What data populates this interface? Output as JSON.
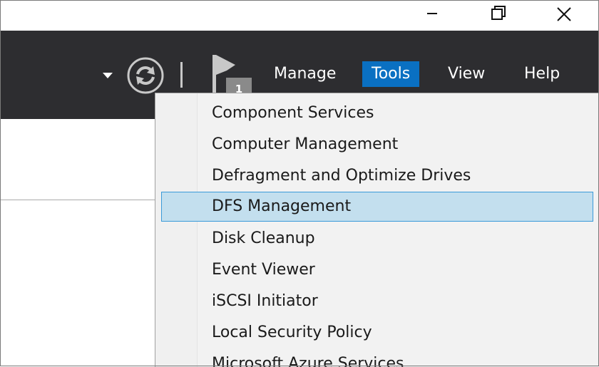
{
  "window_controls": {
    "minimize_icon": "minimize-icon",
    "restore_icon": "restore-icon",
    "close_icon": "close-icon"
  },
  "header": {
    "notification_count": "1",
    "menu": [
      {
        "label": "Manage"
      },
      {
        "label": "Tools",
        "active": true
      },
      {
        "label": "View"
      },
      {
        "label": "Help"
      }
    ]
  },
  "tools_menu": {
    "items": [
      {
        "label": "Component Services"
      },
      {
        "label": "Computer Management"
      },
      {
        "label": "Defragment and Optimize Drives"
      },
      {
        "label": "DFS Management",
        "highlighted": true
      },
      {
        "label": "Disk Cleanup"
      },
      {
        "label": "Event Viewer"
      },
      {
        "label": "iSCSI Initiator"
      },
      {
        "label": "Local Security Policy"
      },
      {
        "label": "Microsoft Azure Services"
      }
    ]
  },
  "colors": {
    "header_bg": "#2d2d30",
    "active_menu": "#0a70c2",
    "highlight_bg": "#c3dfee",
    "highlight_border": "#3a9ad9"
  }
}
